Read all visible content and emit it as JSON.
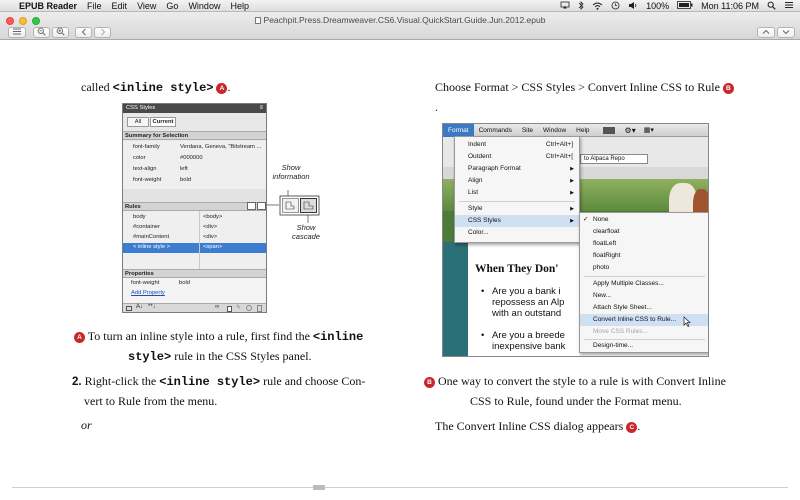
{
  "menubar": {
    "apple": "",
    "app": "EPUB Reader",
    "items": [
      "File",
      "Edit",
      "View",
      "Go",
      "Window",
      "Help"
    ],
    "battery": "100%",
    "clock": "Mon 11:06 PM"
  },
  "window": {
    "title": "Peachpit.Press.Dreamweaver.CS6.Visual.QuickStart.Guide.Jun.2012.epub"
  },
  "left": {
    "line1_pre": "called ",
    "line1_code": "<inline style>",
    "line1_mark": "A",
    "line1_post": ".",
    "caption_mark": "A",
    "caption_a": " To turn an inline style into a rule, first find the ",
    "caption_code1": "<inline",
    "caption_code2": "style>",
    "caption_b": " rule in the CSS Styles panel.",
    "step_num": "2.",
    "step_a": " Right-click the ",
    "step_code": "<inline style>",
    "step_b": " rule and choose Con-",
    "step_c": "vert to Rule from the menu.",
    "or": "or"
  },
  "right": {
    "line1": "Choose Format > CSS Styles > Convert Inline CSS to Rule ",
    "line1_mark": "B",
    "line2": ".",
    "caption_mark": "B",
    "caption_a": " One way to convert the style to a rule is with Convert Inline",
    "caption_b": "CSS to Rule, found under the Format menu.",
    "para": "The Convert Inline CSS dialog appears ",
    "para_mark": "C",
    "para_end": "."
  },
  "css_panel": {
    "title": "CSS Styles",
    "tab_all": "All",
    "tab_current": "Current",
    "summary_header": "Summary for Selection",
    "summary": [
      {
        "prop": "font-family",
        "val": "Verdana, Geneva, \"Bitstream ..."
      },
      {
        "prop": "color",
        "val": "#000000"
      },
      {
        "prop": "text-align",
        "val": "left"
      },
      {
        "prop": "font-weight",
        "val": "bold"
      }
    ],
    "rules_header": "Rules",
    "rules": [
      {
        "name": "body",
        "tag": "<body>"
      },
      {
        "name": "#container",
        "tag": "<div>"
      },
      {
        "name": "#mainContent",
        "tag": "<div>"
      },
      {
        "name": "< inline style >",
        "tag": "<span>"
      }
    ],
    "props_header": "Properties",
    "prop_name": "font-weight",
    "prop_val": "bold",
    "add_property": "Add Property",
    "show_information": "Show information",
    "show_cascade": "Show cascade"
  },
  "dw": {
    "menu": [
      "Format",
      "Commands",
      "Site",
      "Window",
      "Help"
    ],
    "format_items": [
      {
        "label": "Indent",
        "shortcut": "Ctrl+Alt+]",
        "sub": false
      },
      {
        "label": "Outdent",
        "shortcut": "Ctrl+Alt+[",
        "sub": false
      },
      {
        "label": "Paragraph Format",
        "shortcut": "",
        "sub": true
      },
      {
        "label": "Align",
        "shortcut": "",
        "sub": true
      },
      {
        "label": "List",
        "shortcut": "",
        "sub": true
      },
      {
        "label": "Style",
        "shortcut": "",
        "sub": true
      },
      {
        "label": "CSS Styles",
        "shortcut": "",
        "sub": true
      },
      {
        "label": "Color...",
        "shortcut": "",
        "sub": false
      }
    ],
    "css_items": [
      {
        "label": "None",
        "checked": true
      },
      {
        "label": "clearfloat"
      },
      {
        "label": "floatLeft"
      },
      {
        "label": "floatRight"
      },
      {
        "label": "photo"
      },
      {
        "label": "Apply Multiple Classes..."
      },
      {
        "label": "New..."
      },
      {
        "label": "Attach Style Sheet..."
      },
      {
        "label": "Convert Inline CSS to Rule...",
        "highlight": true
      },
      {
        "label": "Move CSS Rules...",
        "disabled": true
      },
      {
        "label": "Design-time..."
      }
    ],
    "url_text": "to Alpaca Repo",
    "heading": "When They Don'",
    "bullets": [
      [
        "Are you a bank i",
        "repossess an Alp",
        "with an outstand"
      ],
      [
        "Are you a breede",
        "inexpensive bank"
      ]
    ]
  },
  "colors": {
    "accent": "#3b78c6",
    "marker": "#c8282d",
    "teal": "#2b6f78"
  }
}
